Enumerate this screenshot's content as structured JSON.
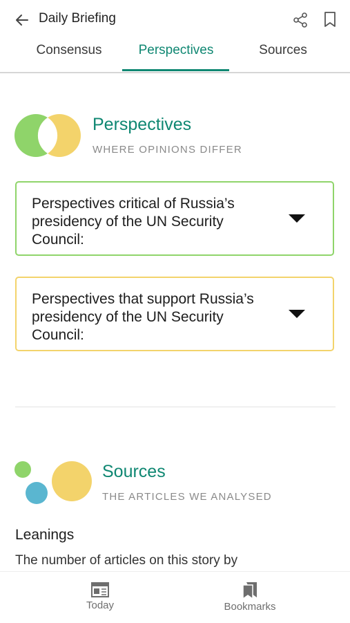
{
  "header": {
    "title": "Daily Briefing",
    "back_icon": "arrow-left-icon",
    "share_icon": "share-icon",
    "bookmark_icon": "bookmark-icon"
  },
  "tabs": [
    {
      "label": "Consensus",
      "active": false
    },
    {
      "label": "Perspectives",
      "active": true
    },
    {
      "label": "Sources",
      "active": false
    }
  ],
  "perspectives": {
    "title": "Perspectives",
    "subtitle": "WHERE OPINIONS DIFFER",
    "cards": [
      {
        "text": "Perspectives critical of Russia’s presidency of the UN Security Council:",
        "color": "#8fd46a"
      },
      {
        "text": "Perspectives that support Russia’s presidency of the UN Security Council:",
        "color": "#f3d36b"
      }
    ]
  },
  "sources": {
    "title": "Sources",
    "subtitle": "THE ARTICLES WE ANALYSED",
    "leanings_heading": "Leanings",
    "description": "The number of articles on this story by"
  },
  "bottom_nav": {
    "today": "Today",
    "bookmarks": "Bookmarks"
  },
  "colors": {
    "accent": "#0f8772",
    "green": "#8fd46a",
    "yellow": "#f3d36b",
    "blue": "#5ab6d0"
  }
}
